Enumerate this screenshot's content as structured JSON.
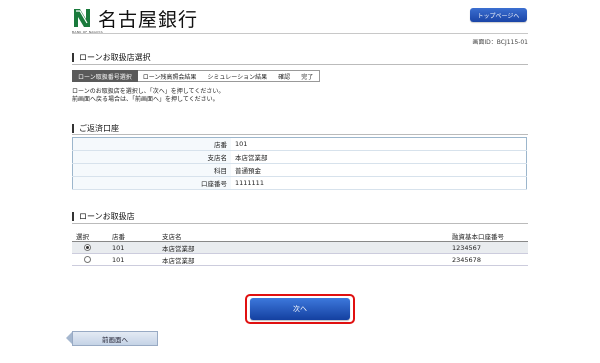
{
  "header": {
    "bank_name": "名古屋銀行",
    "logo_sub": "BANK OF NAGOYA",
    "top_button": "トップページへ",
    "screen_id": "画面ID：BCJ115-01"
  },
  "page_title": "ローンお取扱店選択",
  "steps": [
    "ローン取扱番号選択",
    "ローン残高照会結果",
    "シミュレーション結果",
    "確認",
    "完了"
  ],
  "instructions": [
    "ローンのお取扱店を選択し、「次へ」を押してください。",
    "前画面へ戻る場合は、「前画面へ」を押してください。"
  ],
  "repayment": {
    "title": "ご返済口座",
    "rows": [
      {
        "label": "店番",
        "value": "101"
      },
      {
        "label": "支店名",
        "value": "本店営業部"
      },
      {
        "label": "科目",
        "value": "普通預金"
      },
      {
        "label": "口座番号",
        "value": "1111111"
      }
    ]
  },
  "branch": {
    "title": "ローンお取扱店",
    "headers": [
      "選択",
      "店番",
      "支店名",
      "融資基本口座番号"
    ],
    "rows": [
      {
        "selected": true,
        "no": "101",
        "name": "本店営業部",
        "account": "1234567"
      },
      {
        "selected": false,
        "no": "101",
        "name": "本店営業部",
        "account": "2345678"
      }
    ]
  },
  "buttons": {
    "next": "次へ",
    "back": "前画面へ"
  },
  "colors": {
    "primary_button": "#1f4fb4",
    "highlight_border": "#e01010",
    "logo_green": "#1a7a3c"
  }
}
